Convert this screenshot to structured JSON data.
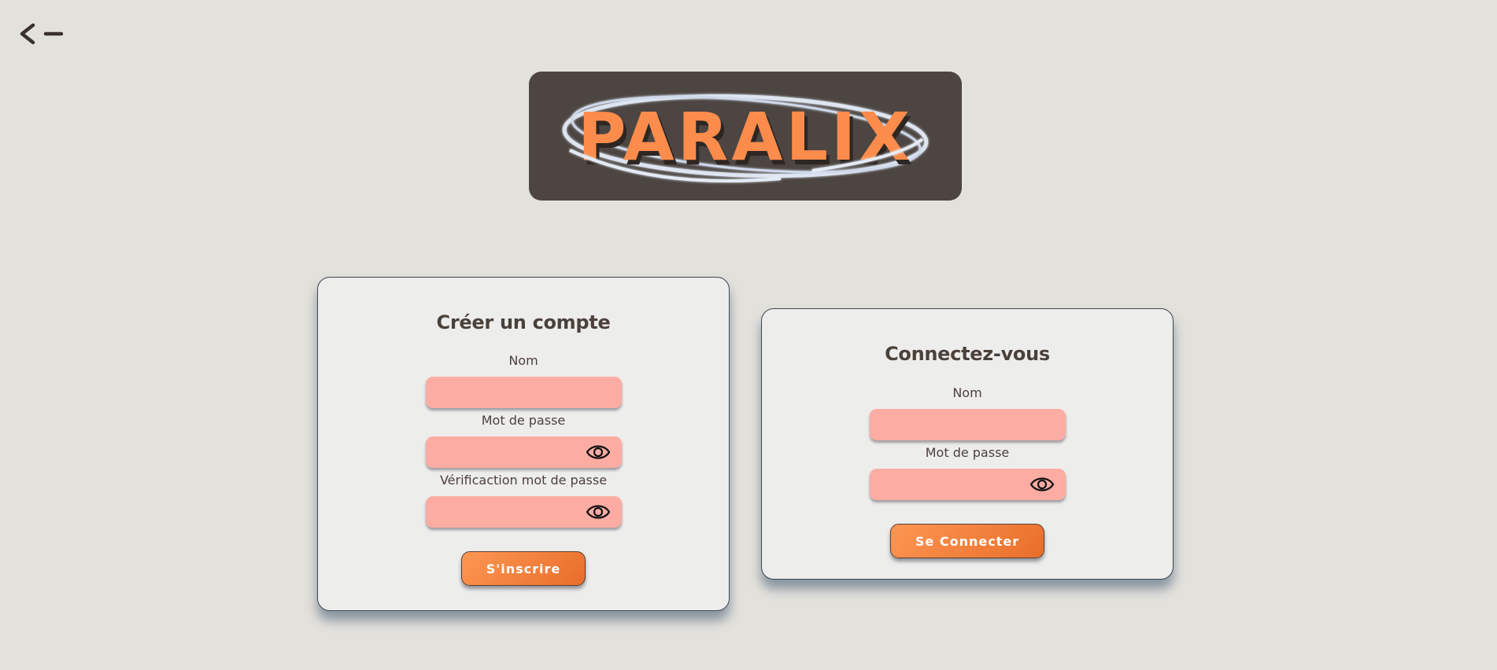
{
  "header": {
    "back_icon": "arrow-left-icon"
  },
  "logo": {
    "text": "PARALIX"
  },
  "signup": {
    "title": "Créer un compte",
    "name_label": "Nom",
    "name_value": "",
    "password_label": "Mot de passe",
    "password_value": "",
    "password_icon": "eye-icon",
    "verify_label": "Vérificaction mot de passe",
    "verify_value": "",
    "verify_icon": "eye-icon",
    "submit_label": "S'inscrire"
  },
  "login": {
    "title": "Connectez-vous",
    "name_label": "Nom",
    "name_value": "",
    "password_label": "Mot de passe",
    "password_value": "",
    "password_icon": "eye-icon",
    "submit_label": "Se Connecter"
  },
  "colors": {
    "background": "#e3e1dc",
    "card": "#ededec",
    "input": "#fdaca3",
    "accent": "#f58a45",
    "text": "#4b413b",
    "logo_bg": "#4c4541"
  }
}
